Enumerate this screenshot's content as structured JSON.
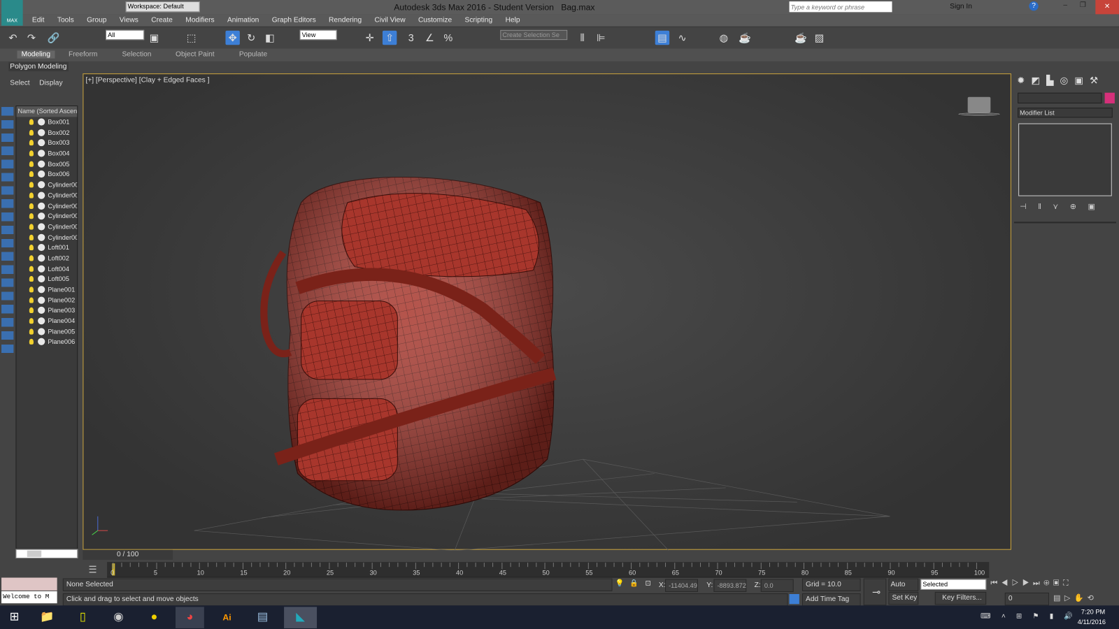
{
  "title": {
    "app": "Autodesk 3ds Max 2016 - Student Version",
    "file": "Bag.max",
    "workspace": "Workspace: Default",
    "search_placeholder": "Type a keyword or phrase",
    "sign_in": "Sign In",
    "logo": "MAX"
  },
  "menu": [
    "Edit",
    "Tools",
    "Group",
    "Views",
    "Create",
    "Modifiers",
    "Animation",
    "Graph Editors",
    "Rendering",
    "Civil View",
    "Customize",
    "Scripting",
    "Help"
  ],
  "toolbar": {
    "filter": "All",
    "ref_coord": "View",
    "selection_set": "Create Selection Se"
  },
  "ribbon": {
    "tabs": [
      "Modeling",
      "Freeform",
      "Selection",
      "Object Paint",
      "Populate"
    ],
    "active": "Modeling",
    "panel": "Polygon Modeling"
  },
  "explorer": {
    "tabs": [
      "Select",
      "Display"
    ],
    "column": "Name (Sorted Ascend",
    "items": [
      "Box001",
      "Box002",
      "Box003",
      "Box004",
      "Box005",
      "Box006",
      "Cylinder00",
      "Cylinder00",
      "Cylinder00",
      "Cylinder00",
      "Cylinder00",
      "Cylinder00",
      "Loft001",
      "Loft002",
      "Loft004",
      "Loft005",
      "Plane001",
      "Plane002",
      "Plane003",
      "Plane004",
      "Plane005",
      "Plane006"
    ]
  },
  "viewport": {
    "label": "[+] [Perspective] [Clay + Edged Faces ]",
    "model_color": "#a8362c"
  },
  "command_panel": {
    "modifier_list": "Modifier List",
    "color_swatch": "#d6307a"
  },
  "timeline": {
    "frame": "0 / 100",
    "ticks": [
      "0",
      "5",
      "10",
      "15",
      "20",
      "25",
      "30",
      "35",
      "40",
      "45",
      "50",
      "55",
      "60",
      "65",
      "70",
      "75",
      "80",
      "85",
      "90",
      "95",
      "100"
    ]
  },
  "status": {
    "selection": "None Selected",
    "prompt": "Click and drag to select and move objects",
    "maxscript": "Welcome to M",
    "x": "-11404.49",
    "y": "-8893.872",
    "z": "0.0",
    "grid": "Grid = 10.0",
    "add_time_tag": "Add Time Tag",
    "auto_key": "Auto Key",
    "set_key": "Set Key",
    "key_mode": "Selected",
    "key_filters": "Key Filters...",
    "current_frame": "0"
  },
  "taskbar": {
    "time": "7:20 PM",
    "date": "4/11/2016"
  }
}
